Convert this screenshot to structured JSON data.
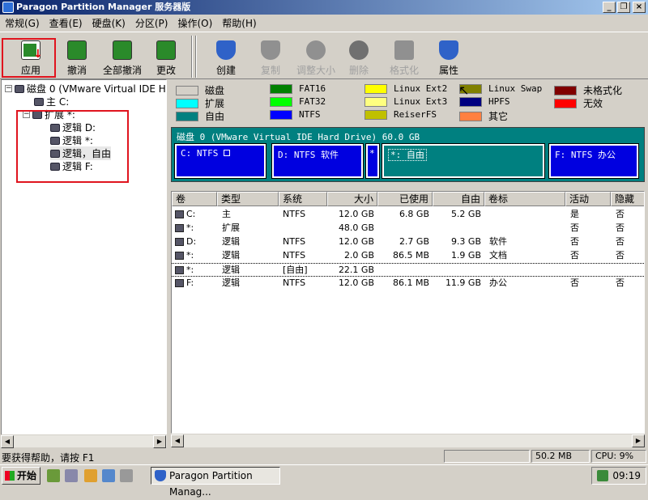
{
  "window": {
    "title": "Paragon Partition Manager 服务器版"
  },
  "menu": [
    "常规(G)",
    "查看(E)",
    "硬盘(K)",
    "分区(P)",
    "操作(O)",
    "帮助(H)"
  ],
  "toolbar": {
    "apply": "应用",
    "undo": "撤消",
    "undo_all": "全部撤消",
    "changes": "更改",
    "create": "创建",
    "copy": "复制",
    "resize": "调整大小",
    "delete": "删除",
    "format": "格式化",
    "properties": "属性"
  },
  "tree": {
    "disk": "磁盘 0 (VMware Virtual IDE Hard",
    "primary": "主 C:",
    "extended": "扩展 *:",
    "logical_d": "逻辑 D:",
    "logical_star": "逻辑 *:",
    "logical_free": "逻辑，自由",
    "logical_f": "逻辑 F:"
  },
  "legend": {
    "disk": "磁盘",
    "fat16": "FAT16",
    "linux_ext2": "Linux Ext2",
    "linux_swap": "Linux Swap",
    "unformatted": "未格式化",
    "extended": "扩展",
    "fat32": "FAT32",
    "linux_ext3": "Linux Ext3",
    "hpfs": "HPFS",
    "invalid": "无效",
    "free": "自由",
    "ntfs": "NTFS",
    "reiserfs": "ReiserFS",
    "other": "其它"
  },
  "colors": {
    "disk": "#d4d0c8",
    "extended": "#00ffff",
    "free": "#008080",
    "fat16": "#008000",
    "fat32": "#00ff00",
    "ntfs": "#0000ff",
    "linux_ext2": "#ffff00",
    "linux_ext3": "#ffff80",
    "reiserfs": "#c0c000",
    "linux_swap": "#808000",
    "hpfs": "#000080",
    "other": "#ff8040",
    "unformatted": "#800000",
    "invalid": "#ff0000"
  },
  "diskmap": {
    "label": "磁盘 0 (VMware Virtual IDE Hard Drive) 60.0 GB",
    "c": "C: NTFS",
    "d": "D: NTFS 软件",
    "star": "*",
    "free": "*: 自由",
    "f": "F: NTFS 办公"
  },
  "table": {
    "headers": [
      "卷",
      "类型",
      "系统",
      "大小",
      "已使用",
      "自由",
      "卷标",
      "活动",
      "隐藏"
    ],
    "rows": [
      {
        "vol": "C:",
        "type": "主",
        "fs": "NTFS",
        "size": "12.0 GB",
        "used": "6.8 GB",
        "free": "5.2 GB",
        "label": "",
        "active": "是",
        "hidden": "否"
      },
      {
        "vol": "*:",
        "type": "扩展",
        "fs": "",
        "size": "48.0 GB",
        "used": "",
        "free": "",
        "label": "",
        "active": "否",
        "hidden": "否"
      },
      {
        "vol": "D:",
        "type": "逻辑",
        "fs": "NTFS",
        "size": "12.0 GB",
        "used": "2.7 GB",
        "free": "9.3 GB",
        "label": "软件",
        "active": "否",
        "hidden": "否"
      },
      {
        "vol": "*:",
        "type": "逻辑",
        "fs": "NTFS",
        "size": "2.0 GB",
        "used": "86.5 MB",
        "free": "1.9 GB",
        "label": "文档",
        "active": "否",
        "hidden": "否"
      },
      {
        "vol": "*:",
        "type": "逻辑",
        "fs": "[自由]",
        "size": "22.1 GB",
        "used": "",
        "free": "",
        "label": "",
        "active": "",
        "hidden": ""
      },
      {
        "vol": "F:",
        "type": "逻辑",
        "fs": "NTFS",
        "size": "12.0 GB",
        "used": "86.1 MB",
        "free": "11.9 GB",
        "label": "办公",
        "active": "否",
        "hidden": "否"
      }
    ]
  },
  "status": {
    "help": "要获得帮助，请按 F1",
    "memory": "50.2 MB",
    "cpu": "CPU: 9%"
  },
  "taskbar": {
    "start": "开始",
    "task": "Paragon Partition Manag...",
    "clock": "09:19"
  }
}
